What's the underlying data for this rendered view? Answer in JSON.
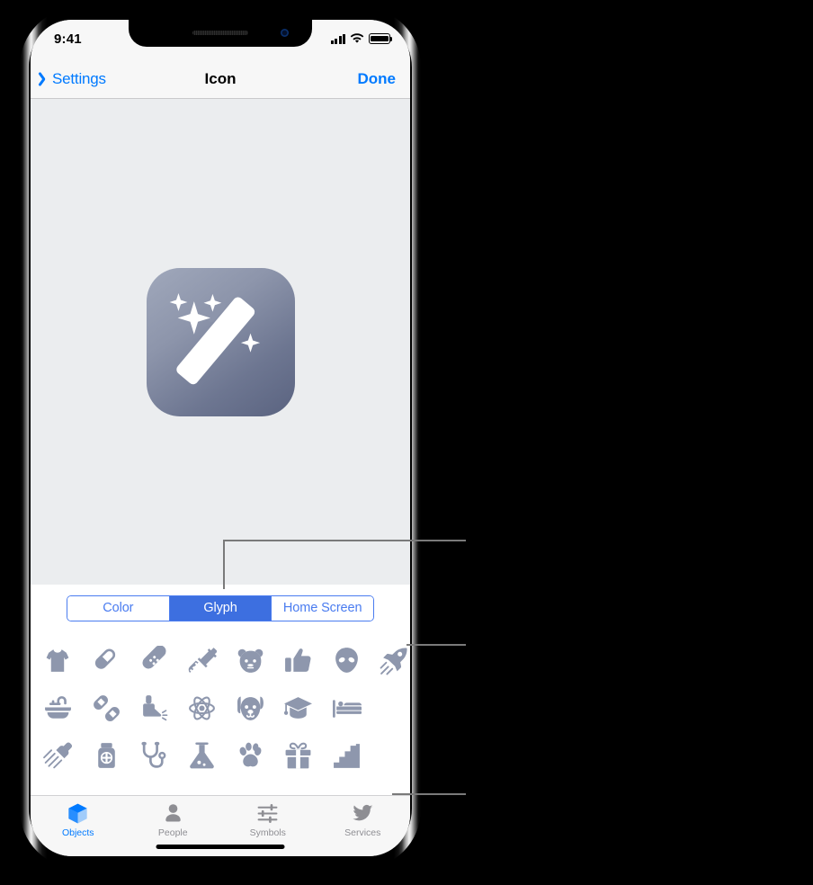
{
  "status_bar": {
    "time": "9:41",
    "cellular_icon": "cellular-bars-icon",
    "wifi_icon": "wifi-icon",
    "battery_icon": "battery-full-icon"
  },
  "nav_bar": {
    "back_label": "Settings",
    "back_icon": "chevron-left-icon",
    "title": "Icon",
    "done_label": "Done"
  },
  "preview": {
    "icon_name": "magic-wand-app-icon",
    "gradient_start": "#a0a8bb",
    "gradient_end": "#5a6380"
  },
  "segmented_control": {
    "options": [
      "Color",
      "Glyph",
      "Home Screen"
    ],
    "selected": "Glyph",
    "accent_color": "#3d6fe0"
  },
  "glyph_grid": {
    "glyph_color": "#8e97ad",
    "rows": [
      [
        {
          "name": "tshirt-glyph"
        },
        {
          "name": "pill-capsule-glyph"
        },
        {
          "name": "bandage-glyph"
        },
        {
          "name": "syringe-glyph"
        },
        {
          "name": "bear-face-glyph"
        },
        {
          "name": "thumbs-up-glyph"
        },
        {
          "name": "alien-glyph"
        },
        {
          "name": "rocket-glyph"
        }
      ],
      [
        {
          "name": "bathtub-glyph"
        },
        {
          "name": "two-pills-glyph"
        },
        {
          "name": "inhaler-glyph"
        },
        {
          "name": "atom-glyph"
        },
        {
          "name": "dog-face-glyph"
        },
        {
          "name": "graduation-cap-glyph"
        },
        {
          "name": "bed-glyph"
        }
      ],
      [
        {
          "name": "shower-head-glyph"
        },
        {
          "name": "medicine-bottle-glyph"
        },
        {
          "name": "stethoscope-glyph"
        },
        {
          "name": "flask-glyph"
        },
        {
          "name": "paw-print-glyph"
        },
        {
          "name": "gift-box-glyph"
        },
        {
          "name": "stairs-glyph"
        }
      ]
    ]
  },
  "tab_bar": {
    "selected": "Objects",
    "accent_color": "#007aff",
    "inactive_color": "#8e8e93",
    "tabs": [
      {
        "label": "Objects",
        "icon": "cube-icon"
      },
      {
        "label": "People",
        "icon": "person-icon"
      },
      {
        "label": "Symbols",
        "icon": "sliders-icon"
      },
      {
        "label": "Services",
        "icon": "bird-icon"
      }
    ]
  },
  "callouts": [
    {
      "name": "callout-segmented-control",
      "target": "Glyph"
    },
    {
      "name": "callout-glyph-grid",
      "target": "rocket-glyph"
    },
    {
      "name": "callout-tab-bar",
      "target": "Services"
    }
  ]
}
